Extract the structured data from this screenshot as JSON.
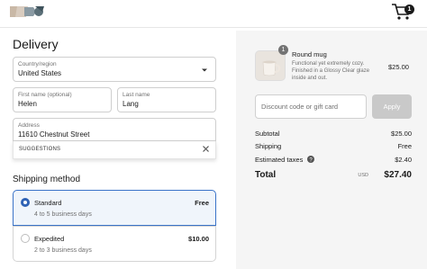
{
  "header": {
    "logo_icon": "brand-logo-icon",
    "cart_icon": "shopping-cart-icon",
    "cart_count": "1"
  },
  "delivery": {
    "title": "Delivery",
    "country_label": "Country/region",
    "country_value": "United States",
    "first_name_label": "First name (optional)",
    "first_name_value": "Helen",
    "last_name_label": "Last name",
    "last_name_value": "Lang",
    "address_label": "Address",
    "address_value": "11610 Chestnut Street",
    "suggestions_label": "SUGGESTIONS"
  },
  "shipping": {
    "title": "Shipping method",
    "options": [
      {
        "name": "Standard",
        "subtitle": "4 to 5 business days",
        "price": "Free",
        "selected": true
      },
      {
        "name": "Expedited",
        "subtitle": "2 to 3 business days",
        "price": "$10.00",
        "selected": false
      }
    ]
  },
  "summary": {
    "product": {
      "quantity": "1",
      "title": "Round mug",
      "description": "Functional yet extremely cozy. Finished in a Glossy Clear glaze inside and out.",
      "price": "$25.00"
    },
    "discount_placeholder": "Discount code or gift card",
    "apply_label": "Apply",
    "subtotal_label": "Subtotal",
    "subtotal_value": "$25.00",
    "shipping_label": "Shipping",
    "shipping_value": "Free",
    "taxes_label": "Estimated taxes",
    "taxes_value": "$2.40",
    "total_label": "Total",
    "currency": "USD",
    "total_value": "$27.40"
  },
  "colors": {
    "accent": "#2f62b5",
    "selected_bg": "#f0f5fb",
    "summary_bg": "#f5f5f5",
    "apply_bg": "#c9c9c9"
  }
}
